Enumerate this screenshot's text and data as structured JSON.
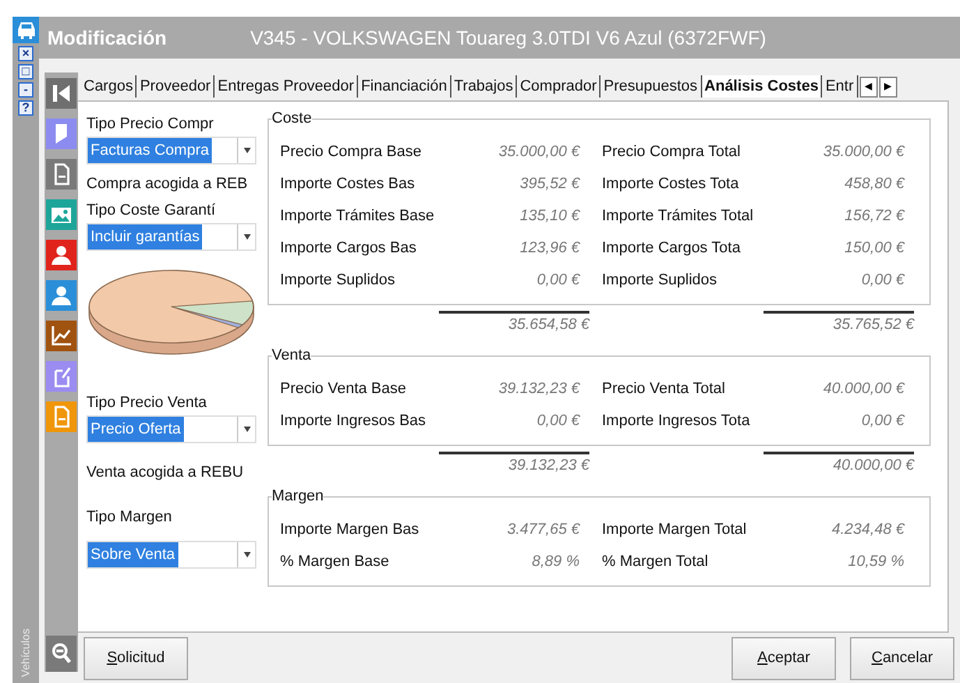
{
  "window": {
    "title": "Modificación",
    "subtitle": "V345 - VOLKSWAGEN Touareg 3.0TDI V6 Azul (6372FWF)",
    "side_label": "Vehículos",
    "controls": [
      "×",
      "□",
      "-",
      "?"
    ]
  },
  "tabs": [
    {
      "label": "Cargos",
      "selected": false
    },
    {
      "label": "Proveedor",
      "selected": false
    },
    {
      "label": "Entregas Proveedor",
      "selected": false
    },
    {
      "label": "Financiación",
      "selected": false
    },
    {
      "label": "Trabajos",
      "selected": false
    },
    {
      "label": "Comprador",
      "selected": false
    },
    {
      "label": "Presupuestos",
      "selected": false
    },
    {
      "label": "Análisis Costes",
      "selected": true
    },
    {
      "label": "Entr",
      "selected": false
    }
  ],
  "tab_scroll": [
    "◀",
    "▶"
  ],
  "left_panel": [
    {
      "kind": "label",
      "text": "Tipo Precio Compr"
    },
    {
      "kind": "combo",
      "value": "Facturas Compra"
    },
    {
      "kind": "label",
      "text": "Compra acogida a REB"
    },
    {
      "kind": "label",
      "text": "Tipo Coste Garantí"
    },
    {
      "kind": "combo",
      "value": "Incluir garantías"
    },
    {
      "kind": "pie"
    },
    {
      "kind": "label",
      "text": "Tipo Precio Venta"
    },
    {
      "kind": "combo",
      "value": "Precio Oferta"
    },
    {
      "kind": "label",
      "text": "Venta acogida a REBU"
    },
    {
      "kind": "label",
      "text": "Tipo Margen"
    },
    {
      "kind": "combo",
      "value": "Sobre Venta"
    }
  ],
  "groups": [
    {
      "title": "Coste",
      "rows": [
        {
          "base_label": "Precio Compra Base",
          "base_value": "35.000,00 €",
          "total_label": "Precio Compra Total",
          "total_value": "35.000,00 €"
        },
        {
          "base_label": "Importe Costes Bas",
          "base_value": "395,52 €",
          "total_label": "Importe Costes Tota",
          "total_value": "458,80 €"
        },
        {
          "base_label": "Importe Trámites Base",
          "base_value": "135,10 €",
          "total_label": "Importe Trámites Total",
          "total_value": "156,72 €"
        },
        {
          "base_label": "Importe Cargos Bas",
          "base_value": "123,96 €",
          "total_label": "Importe Cargos Tota",
          "total_value": "150,00 €"
        },
        {
          "base_label": "Importe Suplidos",
          "base_value": "0,00 €",
          "total_label": "Importe Suplidos",
          "total_value": "0,00 €"
        }
      ],
      "base_sum": "35.654,58 €",
      "total_sum": "35.765,52 €"
    },
    {
      "title": "Venta",
      "rows": [
        {
          "base_label": "Precio Venta Base",
          "base_value": "39.132,23 €",
          "total_label": "Precio Venta Total",
          "total_value": "40.000,00 €"
        },
        {
          "base_label": "Importe Ingresos Bas",
          "base_value": "0,00 €",
          "total_label": "Importe Ingresos Tota",
          "total_value": "0,00 €"
        }
      ],
      "base_sum": "39.132,23 €",
      "total_sum": "40.000,00 €"
    },
    {
      "title": "Margen",
      "rows": [
        {
          "base_label": "Importe Margen Bas",
          "base_value": "3.477,65 €",
          "total_label": "Importe Margen Total",
          "total_value": "4.234,48 €"
        },
        {
          "base_label": "% Margen Base",
          "base_value": "8,89 %",
          "total_label": "% Margen Total",
          "total_value": "10,59 %"
        }
      ]
    }
  ],
  "left_buttons": [
    "Solicitud"
  ],
  "right_buttons": [
    "Aceptar",
    "Cancelar"
  ]
}
